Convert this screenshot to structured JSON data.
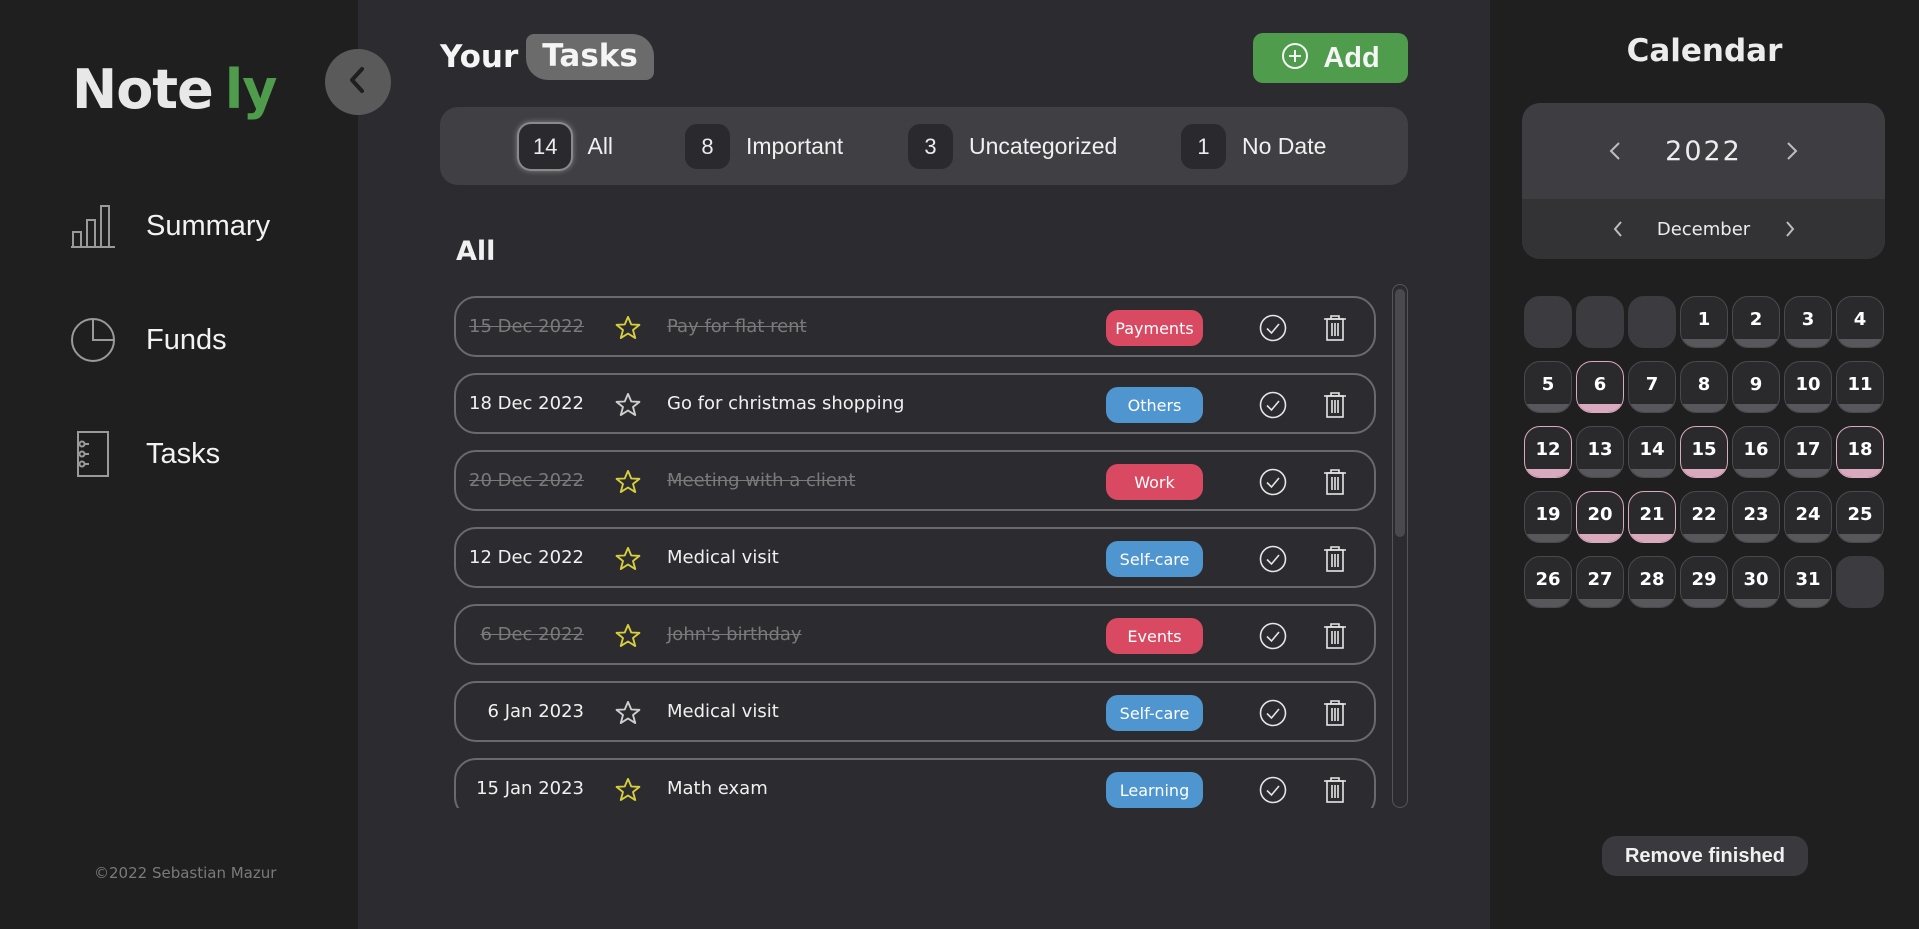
{
  "app": {
    "logo_main": "Note",
    "logo_accent": "ly",
    "footer": "©2022 Sebastian Mazur"
  },
  "sidebar": {
    "items": [
      {
        "label": "Summary",
        "icon": "bar-chart-icon"
      },
      {
        "label": "Funds",
        "icon": "pie-chart-icon"
      },
      {
        "label": "Tasks",
        "icon": "notebook-icon"
      }
    ]
  },
  "header": {
    "your": "Your",
    "tasks": "Tasks",
    "add_label": "Add"
  },
  "filters": [
    {
      "count": "14",
      "label": "All",
      "active": true
    },
    {
      "count": "8",
      "label": "Important",
      "active": false
    },
    {
      "count": "3",
      "label": "Uncategorized",
      "active": false
    },
    {
      "count": "1",
      "label": "No Date",
      "active": false
    }
  ],
  "list": {
    "title": "All",
    "tasks": [
      {
        "date": "15 Dec 2022",
        "title": "Pay for flat rent",
        "tag": "Payments",
        "done": true
      },
      {
        "date": "18 Dec 2022",
        "title": "Go for christmas shopping",
        "tag": "Others",
        "done": false
      },
      {
        "date": "20 Dec 2022",
        "title": "Meeting with a client",
        "tag": "Work",
        "done": true
      },
      {
        "date": "12 Dec 2022",
        "title": "Medical visit",
        "tag": "Self-care",
        "done": false
      },
      {
        "date": "6 Dec 2022",
        "title": "John's birthday",
        "tag": "Events",
        "done": true
      },
      {
        "date": "6 Jan 2023",
        "title": "Medical visit",
        "tag": "Self-care",
        "done": false
      },
      {
        "date": "15 Jan 2023",
        "title": "Math exam",
        "tag": "Learning",
        "done": false
      }
    ]
  },
  "calendar": {
    "title": "Calendar",
    "year": "2022",
    "month": "December",
    "days": [
      "1",
      "2",
      "3",
      "4",
      "5",
      "6",
      "7",
      "8",
      "9",
      "10",
      "11",
      "12",
      "13",
      "14",
      "15",
      "16",
      "17",
      "18",
      "19",
      "20",
      "21",
      "22",
      "23",
      "24",
      "25",
      "26",
      "27",
      "28",
      "29",
      "30",
      "31"
    ],
    "marked_days": [
      "6",
      "12",
      "15",
      "18",
      "20",
      "21"
    ],
    "remove_label": "Remove finished"
  },
  "colors": {
    "accent": "#4f9c4c",
    "tag_red": "#d94a62",
    "tag_blue": "#4f95cf",
    "star_yellow": "#d8cf3c",
    "marked_day": "#d9a9bd"
  }
}
